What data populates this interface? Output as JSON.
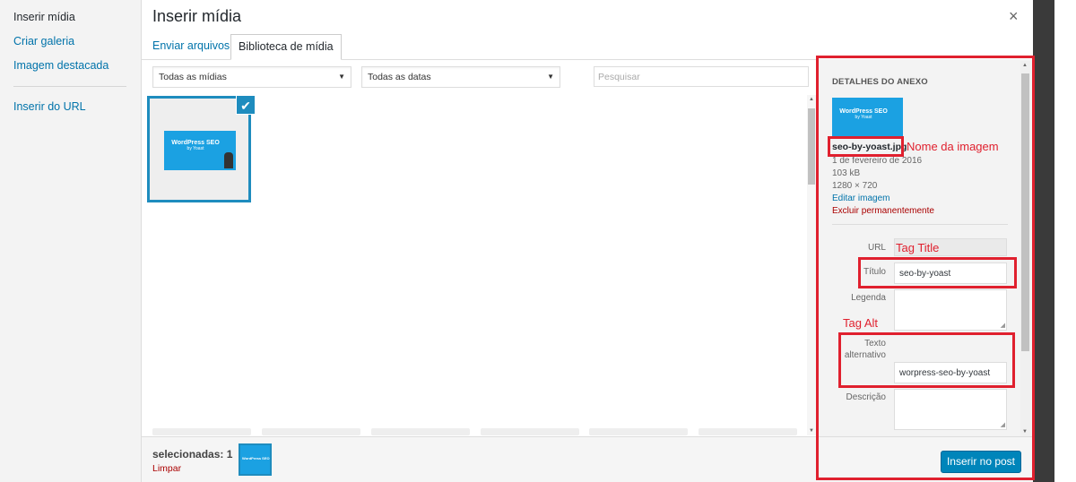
{
  "menu": {
    "items": [
      "Inserir mídia",
      "Criar galeria",
      "Imagem destacada",
      "Inserir do URL"
    ]
  },
  "header": {
    "title": "Inserir mídia",
    "close_icon": "×"
  },
  "tabs": [
    "Enviar arquivos",
    "Biblioteca de mídia"
  ],
  "toolbar": {
    "filter_media": "Todas as mídias",
    "filter_dates": "Todas as datas",
    "search_placeholder": "Pesquisar"
  },
  "thumbnail": {
    "line1": "WordPress SEO",
    "line2": "by Yoast"
  },
  "selection": {
    "count_label": "selecionadas: 1",
    "clear_label": "Limpar",
    "insert_button": "Inserir no post"
  },
  "details": {
    "heading": "DETALHES DO ANEXO",
    "filename": "seo-by-yoast.jpg",
    "date": "1 de fevereiro de 2016",
    "size": "103 kB",
    "dimensions": "1280 × 720",
    "edit_link": "Editar imagem",
    "delete_link": "Excluir permanentemente",
    "fields": {
      "url_label": "URL",
      "url_value": "",
      "title_label": "Título",
      "title_value": "seo-by-yoast",
      "caption_label": "Legenda",
      "caption_value": "",
      "alt_label_1": "Texto",
      "alt_label_2": "alternativo",
      "alt_value": "worpress-seo-by-yoast",
      "description_label": "Descrição",
      "description_value": ""
    }
  },
  "annotations": {
    "image_name": "Nome da imagem",
    "tag_title": "Tag Title",
    "tag_alt": "Tag Alt"
  },
  "colors": {
    "accent": "#0073aa",
    "selection_border": "#1e8cbe",
    "annotation_red": "#e0202e",
    "button": "#0085ba"
  }
}
